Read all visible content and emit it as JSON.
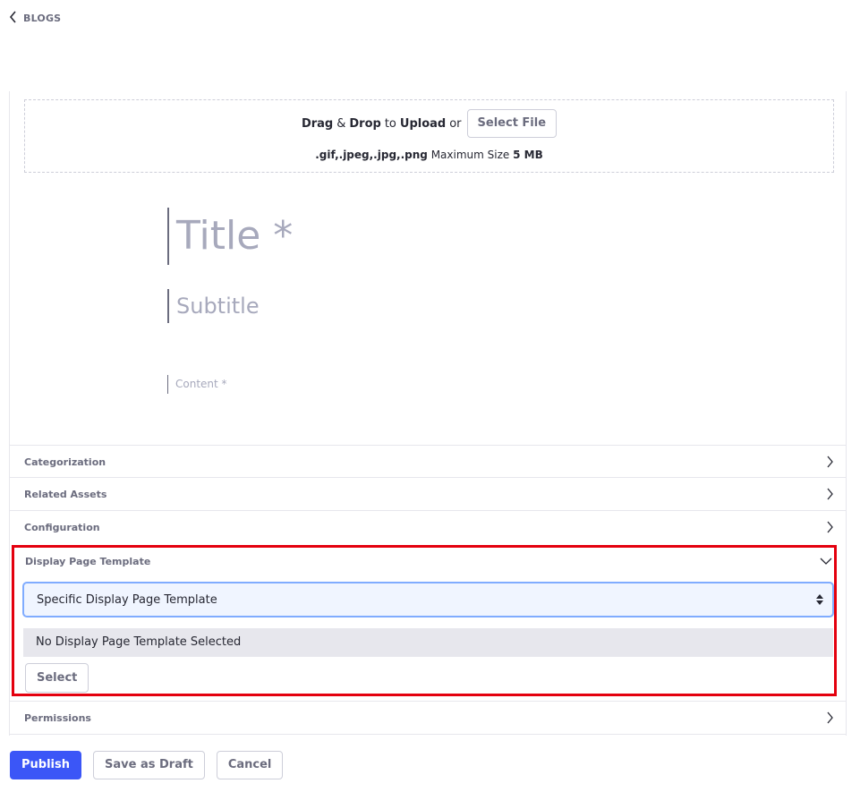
{
  "nav": {
    "back_icon": "chevron-left-icon",
    "back_label": "BLOGS"
  },
  "upload": {
    "drag": "Drag",
    "amp": "&",
    "drop": "Drop",
    "to": "to",
    "upload": "Upload",
    "or": "or",
    "select_file_label": "Select File",
    "extensions": ".gif,.jpeg,.jpg,.png",
    "max_size_label": "Maximum Size",
    "max_size_value": "5 MB"
  },
  "editor": {
    "title_placeholder": "Title *",
    "subtitle_placeholder": "Subtitle",
    "content_placeholder": "Content *"
  },
  "sections": {
    "categorization": "Categorization",
    "related_assets": "Related Assets",
    "configuration": "Configuration",
    "display_page_template": "Display Page Template",
    "permissions": "Permissions"
  },
  "display_page_template": {
    "selected_option": "Specific Display Page Template",
    "current_value": "No Display Page Template Selected",
    "select_label": "Select"
  },
  "footer": {
    "publish_label": "Publish",
    "save_draft_label": "Save as Draft",
    "cancel_label": "Cancel"
  },
  "colors": {
    "primary": "#3b56f7",
    "highlight": "#e4000e",
    "select_focus": "#80acff"
  }
}
